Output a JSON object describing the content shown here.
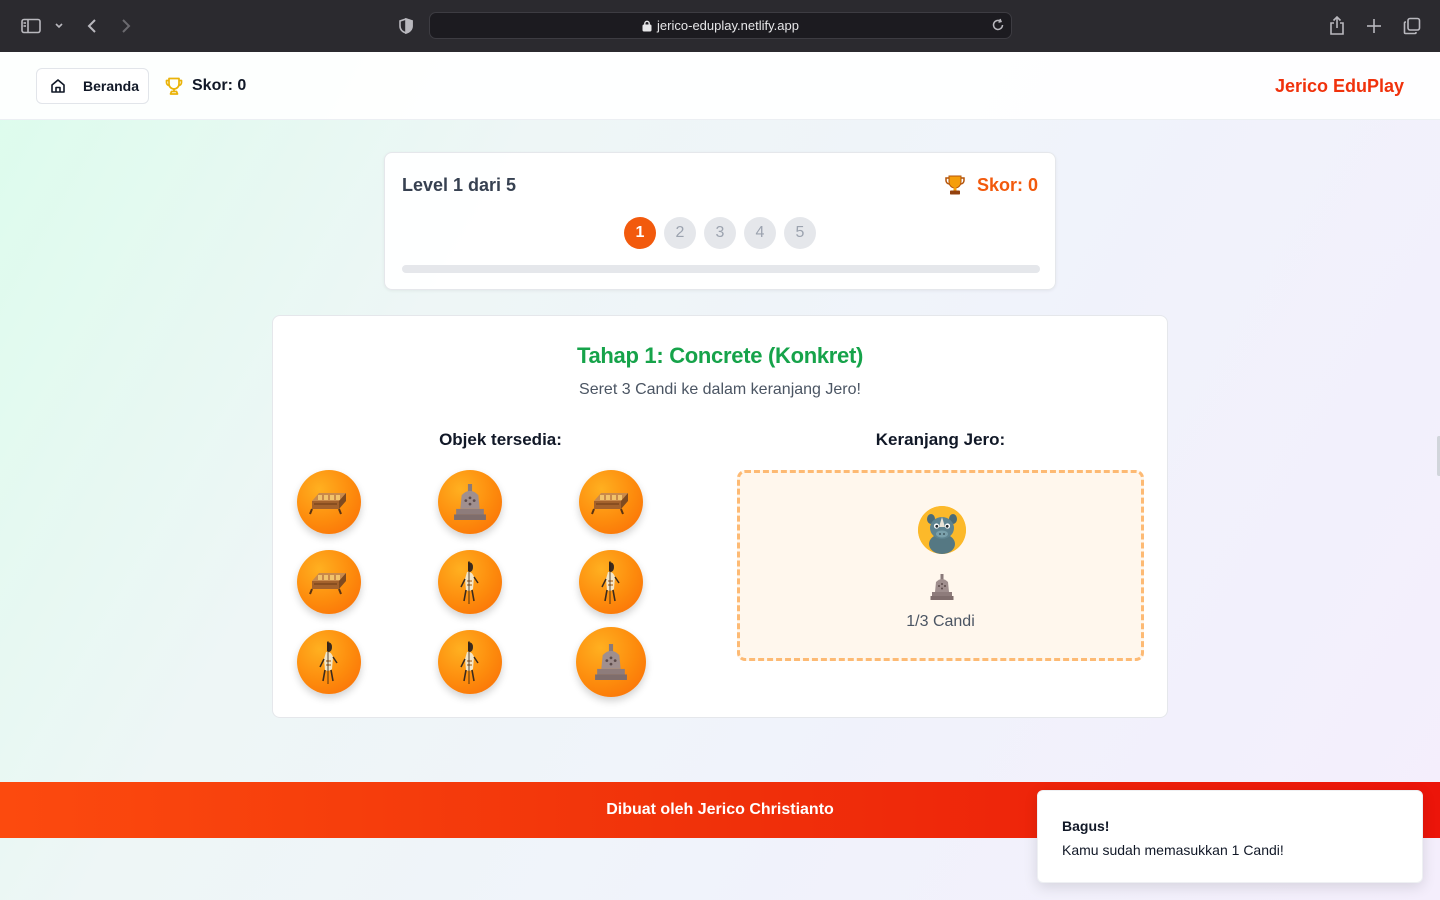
{
  "browser": {
    "url": "jerico-eduplay.netlify.app"
  },
  "topbar": {
    "home_label": "Beranda",
    "score_label": "Skor: 0",
    "brand": "Jerico EduPlay"
  },
  "level": {
    "title": "Level 1 dari 5",
    "score_label": "Skor: 0",
    "steps": [
      "1",
      "2",
      "3",
      "4",
      "5"
    ],
    "active_step": 1,
    "progress_fraction": 0
  },
  "stage": {
    "title": "Tahap 1: Concrete (Konkret)",
    "instruction": "Seret 3 Candi ke dalam keranjang Jero!",
    "objects_heading": "Objek tersedia:",
    "basket_heading": "Keranjang Jero:",
    "objects": [
      {
        "icon": "gamelan-icon"
      },
      {
        "icon": "candi-icon"
      },
      {
        "icon": "gamelan-icon"
      },
      {
        "icon": "gamelan-icon"
      },
      {
        "icon": "wayang-icon"
      },
      {
        "icon": "wayang-icon"
      },
      {
        "icon": "wayang-icon"
      },
      {
        "icon": "wayang-icon"
      },
      {
        "icon": "candi-icon"
      }
    ],
    "basket_count": "1/3 Candi"
  },
  "footer": {
    "text": "Dibuat oleh Jerico Christianto"
  },
  "toast": {
    "title": "Bagus!",
    "message": "Kamu sudah memasukkan 1 Candi!"
  },
  "colors": {
    "accent": "#f25a0d",
    "brand": "#f0320c",
    "stage_title": "#16a34a",
    "basket_border": "#fdba74"
  }
}
